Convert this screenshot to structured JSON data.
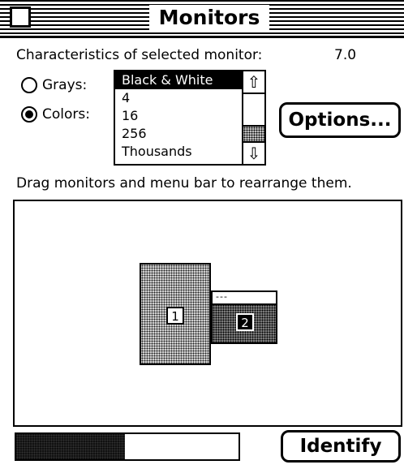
{
  "window": {
    "title": "Monitors"
  },
  "header": {
    "characteristics_label": "Characteristics of selected monitor:",
    "version": "7.0"
  },
  "mode": {
    "grays_label": "Grays:",
    "colors_label": "Colors:",
    "selected": "colors"
  },
  "depth_list": {
    "items": [
      "Black & White",
      "4",
      "16",
      "256",
      "Thousands"
    ],
    "selected_index": 0
  },
  "buttons": {
    "options_label": "Options...",
    "identify_label": "Identify"
  },
  "arrange": {
    "instruction": "Drag monitors and menu bar to rearrange them.",
    "monitors": [
      {
        "number": "1"
      },
      {
        "number": "2"
      }
    ],
    "menu_bar_glyph": "---"
  },
  "bottom_bar": {
    "fill_fraction": 0.49
  },
  "icons": {
    "scroll_up": "up-arrow-icon",
    "scroll_down": "down-arrow-icon",
    "close": "close-box-icon"
  },
  "colors": {
    "foreground": "#000000",
    "background": "#ffffff"
  }
}
